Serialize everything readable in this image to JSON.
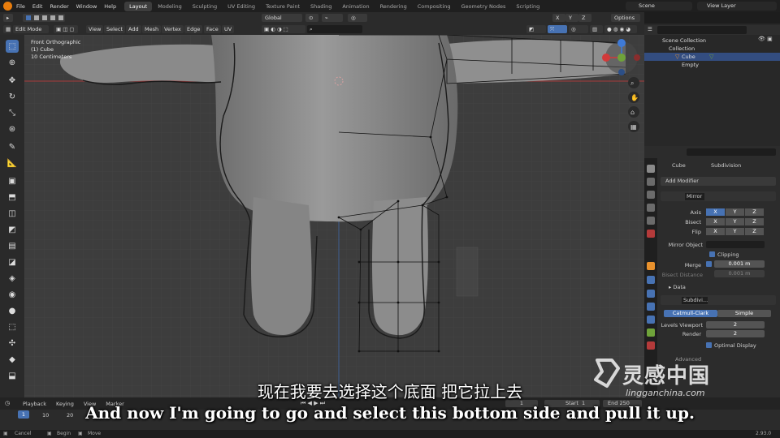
{
  "app": {
    "menu": [
      "File",
      "Edit",
      "Render",
      "Window",
      "Help"
    ],
    "workspace_tabs": [
      "Layout",
      "Modeling",
      "Sculpting",
      "UV Editing",
      "Texture Paint",
      "Shading",
      "Animation",
      "Rendering",
      "Compositing",
      "Geometry Nodes",
      "Scripting"
    ],
    "active_tab": "Layout",
    "scene": "Scene",
    "view_layer": "View Layer"
  },
  "tool_header": {
    "transform_orientation": "Global",
    "options": "Options",
    "xyz": [
      "X",
      "Y",
      "Z"
    ]
  },
  "viewport_header": {
    "mode": "Edit Mode",
    "menus": [
      "View",
      "Select",
      "Add",
      "Mesh",
      "Vertex",
      "Edge",
      "Face",
      "UV"
    ]
  },
  "viewport": {
    "view_name": "Front Orthographic",
    "object": "(1) Cube",
    "scale": "10 Centimeters"
  },
  "outliner": {
    "root": "Scene Collection",
    "collection": "Collection",
    "items": [
      {
        "name": "Cube",
        "selected": true
      },
      {
        "name": "Empty",
        "selected": false
      }
    ]
  },
  "properties": {
    "object": "Cube",
    "modifier_name": "Subdivision",
    "add_modifier": "Add Modifier",
    "mirror": {
      "name": "Mirror",
      "rows": [
        {
          "label": "Axis",
          "values": [
            "X",
            "Y",
            "Z"
          ],
          "active": [
            true,
            false,
            false
          ]
        },
        {
          "label": "Bisect",
          "values": [
            "X",
            "Y",
            "Z"
          ],
          "active": [
            false,
            false,
            false
          ]
        },
        {
          "label": "Flip",
          "values": [
            "X",
            "Y",
            "Z"
          ],
          "active": [
            false,
            false,
            false
          ]
        }
      ],
      "mirror_object_label": "Mirror Object",
      "clipping_label": "Clipping",
      "merge_label": "Merge",
      "merge_value": "0.001 m",
      "bisect_distance_label": "Bisect Distance",
      "bisect_distance_value": "0.001 m",
      "data_label": "Data"
    },
    "subdivision": {
      "name": "Subdivi...",
      "method_a": "Catmull-Clark",
      "method_b": "Simple",
      "levels_viewport_label": "Levels Viewport",
      "levels_viewport": "2",
      "render_label": "Render",
      "render": "2",
      "optimal_display": "Optimal Display",
      "advanced": "Advanced"
    }
  },
  "timeline": {
    "menus": [
      "Playback",
      "Keying",
      "View",
      "Marker"
    ],
    "current_frame": "1",
    "start_label": "Start",
    "start": "1",
    "end_label": "End",
    "end": "250",
    "ruler": [
      "1",
      "10",
      "20"
    ]
  },
  "status": {
    "left": [
      "Cancel",
      "Begin",
      "Move"
    ],
    "version": "2.93.0"
  },
  "subtitles": {
    "cn": "现在我要去选择这个底面 把它拉上去",
    "en": "And now I'm going to go and select this bottom side and pull it up."
  },
  "watermark": {
    "brand": "灵感中国",
    "url": "lingganchina.com"
  },
  "colors": {
    "accent": "#4772b3",
    "selection": "#334d80",
    "viewport_bg": "#3d3d3d",
    "x_axis": "#d23a3a",
    "y_axis": "#6fa33a",
    "z_axis": "#3f7ad6"
  }
}
